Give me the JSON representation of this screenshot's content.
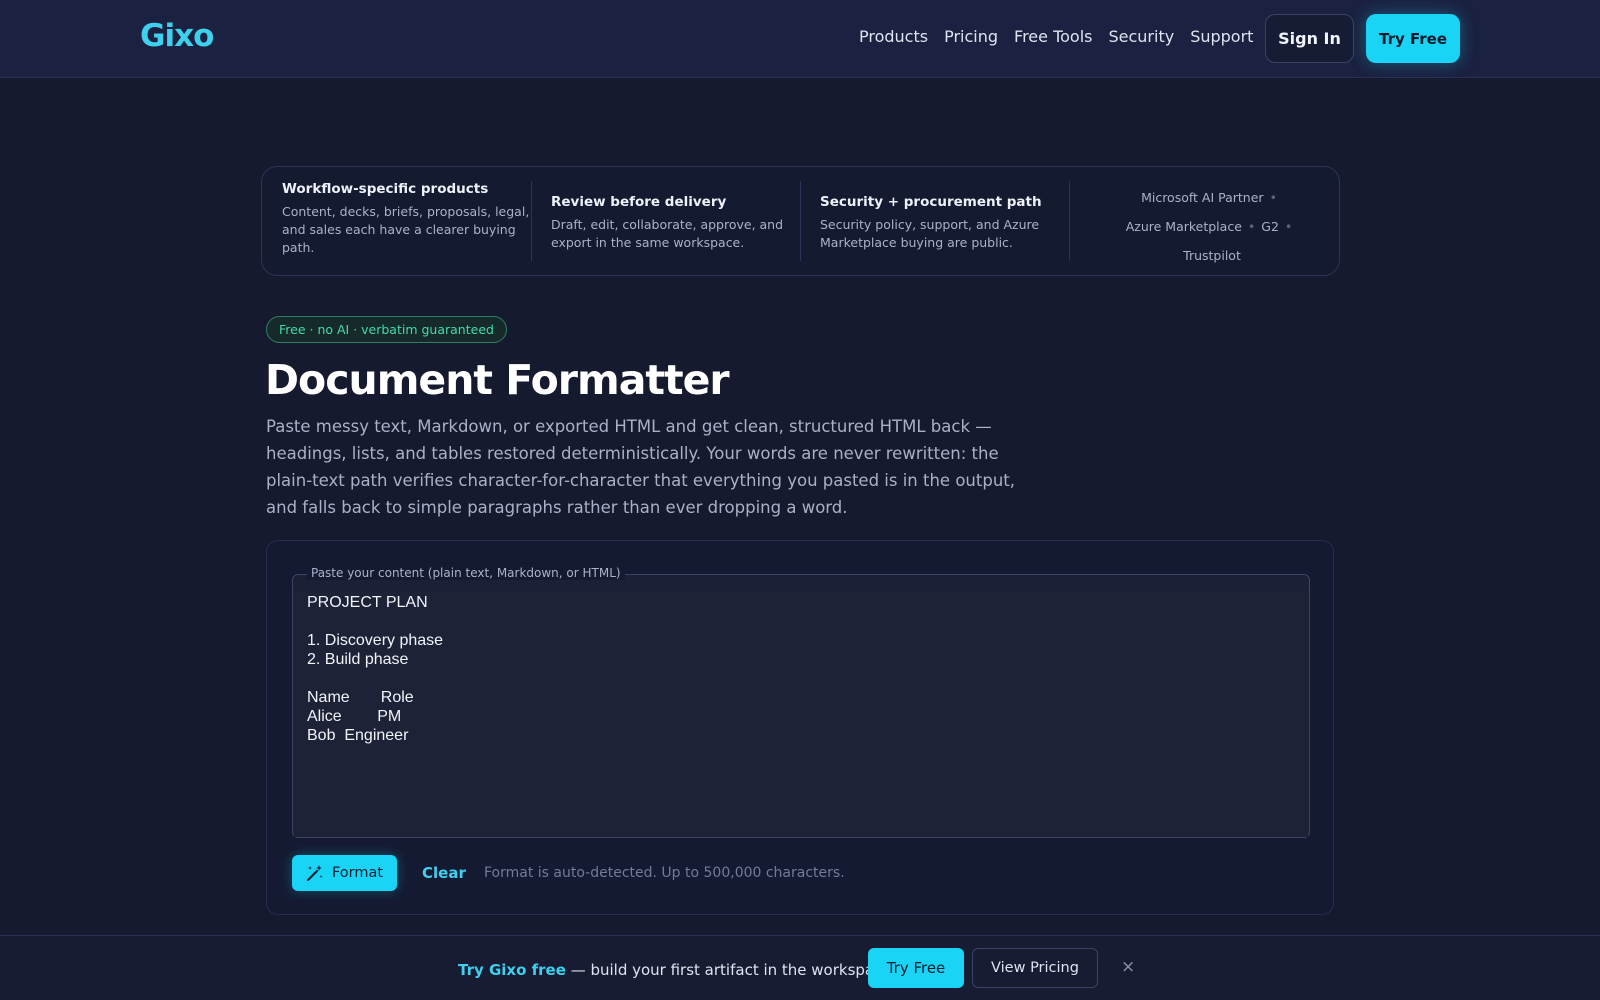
{
  "header": {
    "logo": "Gixo",
    "nav": [
      "Products",
      "Pricing",
      "Free Tools",
      "Security",
      "Support"
    ],
    "sign_in": "Sign In",
    "try_free": "Try Free"
  },
  "features": [
    {
      "title": "Workflow-specific products",
      "desc": "Content, decks, briefs, proposals, legal, and sales each have a clearer buying path."
    },
    {
      "title": "Review before delivery",
      "desc": "Draft, edit, collaborate, approve, and export in the same workspace."
    },
    {
      "title": "Security + procurement path",
      "desc": "Security policy, support, and Azure Marketplace buying are public."
    }
  ],
  "partners": [
    "Microsoft AI Partner",
    "Azure Marketplace",
    "G2",
    "Trustpilot"
  ],
  "badge": "Free · no AI · verbatim guaranteed",
  "title": "Document Formatter",
  "lede": "Paste messy text, Markdown, or exported HTML and get clean, structured HTML back — headings, lists, and tables restored deterministically. Your words are never rewritten: the plain-text path verifies character-for-character that everything you pasted is in the output, and falls back to simple paragraphs rather than ever dropping a word.",
  "editor": {
    "legend": "Paste your content (plain text, Markdown, or HTML)",
    "content": "PROJECT PLAN\n\n1. Discovery phase\n2. Build phase\n\nName       Role\nAlice        PM\nBob  Engineer",
    "format_button": "Format",
    "clear_button": "Clear",
    "hint": "Format is auto-detected. Up to 500,000 characters."
  },
  "bottom_bar": {
    "promo_accent": "Try Gixo free",
    "promo_rest": " — build your first artifact in the workspace",
    "try_free": "Try Free",
    "view_pricing": "View Pricing",
    "close": "×"
  },
  "colors": {
    "accent": "#1ad4f5",
    "badge_green": "#3fdca4",
    "background": "#161a2e"
  },
  "icons": {
    "format": "magic-wand-icon",
    "close": "close-icon"
  }
}
